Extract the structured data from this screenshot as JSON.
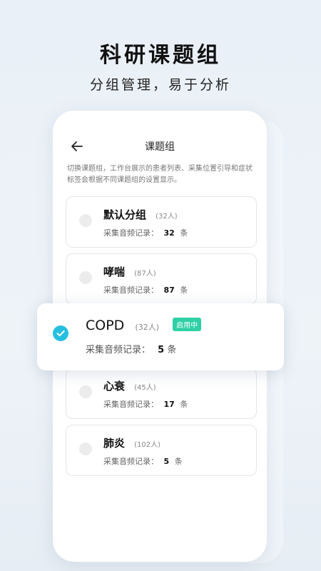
{
  "hero": {
    "title": "科研课题组",
    "subtitle": "分组管理，易于分析"
  },
  "screen": {
    "title": "课题组",
    "description": "切换课题组，工作台展示的患者列表、采集位置引导和症状标签会根据不同课题组的设置显示。"
  },
  "groups": [
    {
      "name": "默认分组",
      "count": "(32人)",
      "record_label": "采集音频记录：",
      "record_count": "32",
      "record_unit": "条"
    },
    {
      "name": "哮喘",
      "count": "(87人)",
      "record_label": "采集音频记录：",
      "record_count": "87",
      "record_unit": "条"
    },
    {
      "name": "COPD",
      "count": "(32人)",
      "badge": "启用中",
      "record_label": "采集音频记录：",
      "record_count": "5",
      "record_unit": "条",
      "selected": true
    },
    {
      "name": "心衰",
      "count": "(45人)",
      "record_label": "采集音频记录：",
      "record_count": "17",
      "record_unit": "条"
    },
    {
      "name": "肺炎",
      "count": "(102人)",
      "record_label": "采集音频记录：",
      "record_count": "5",
      "record_unit": "条"
    }
  ],
  "icons": {
    "back": "arrow-left-icon",
    "check": "check-icon"
  },
  "colors": {
    "accent": "#27bfe0",
    "badge": "#2fd0a5"
  }
}
